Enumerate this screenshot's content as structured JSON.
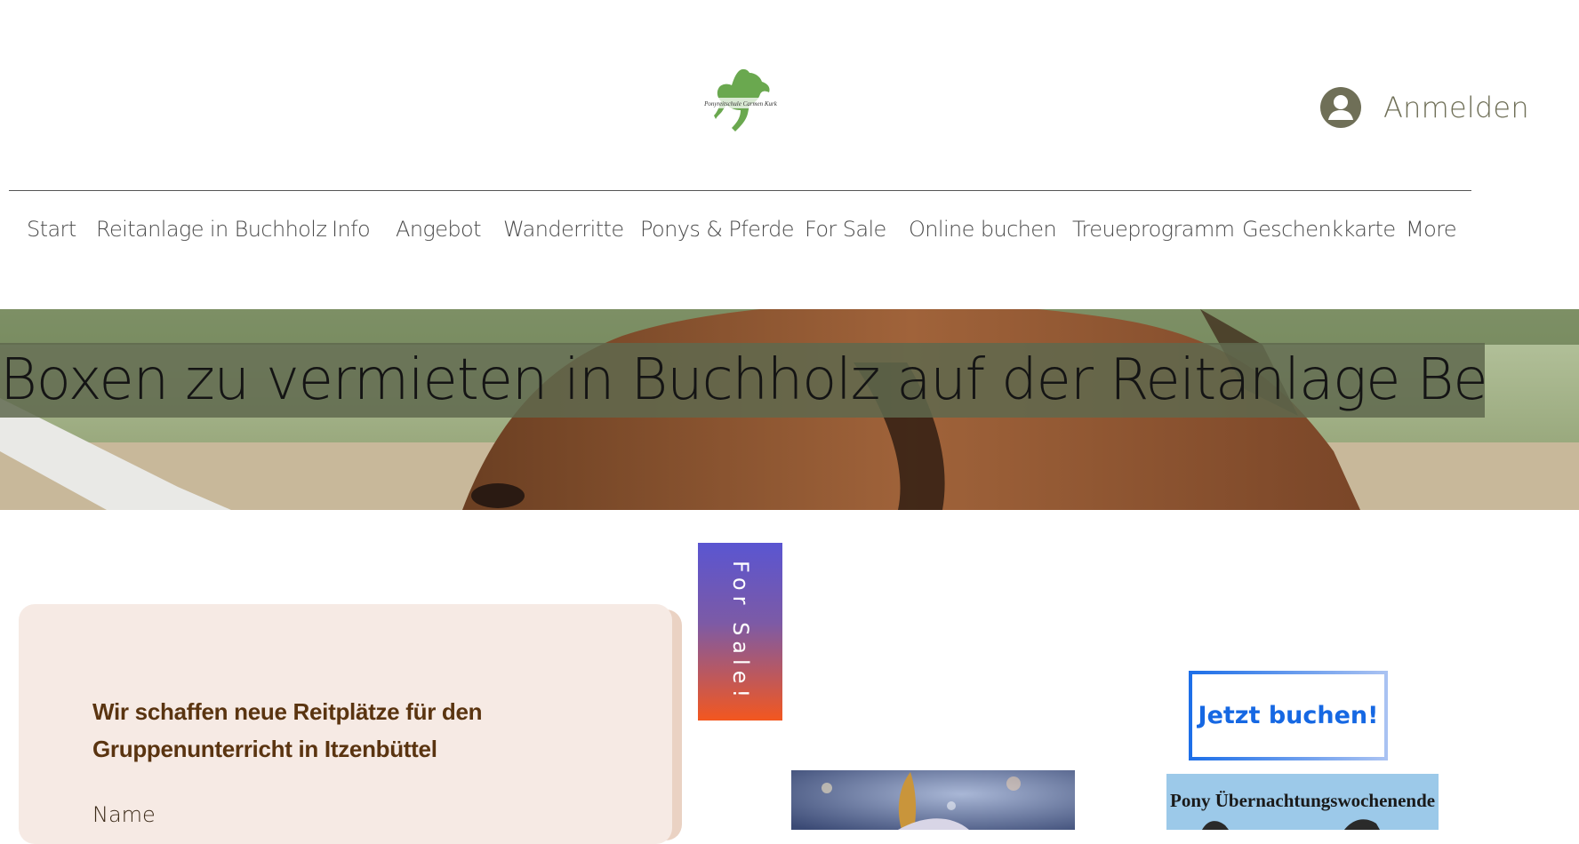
{
  "brand": {
    "logo_text": "Ponyreitschule Carmen Kurk",
    "logo_color": "#6aa84f"
  },
  "header": {
    "login_label": "Anmelden"
  },
  "nav": {
    "items": [
      "Start",
      "Reitanlage in Buchholz",
      "Info",
      "Angebot",
      "Wanderritte",
      "Ponys & Pferde",
      "For Sale",
      "Online buchen",
      "Treueprogramm",
      "Geschenkkarte",
      "More"
    ]
  },
  "hero": {
    "title": "Boxen zu vermieten in Buchholz auf der Reitanlage Behr!"
  },
  "forsale": {
    "label": "For Sale!"
  },
  "form": {
    "heading": "Wir schaffen neue Reitplätze für den Gruppenunterricht in Itzenbüttel",
    "name_label": "Name"
  },
  "cta": {
    "label": "Jetzt buchen!"
  },
  "gallery": {
    "pony_caption": "Pony Übernachtungswochenende"
  },
  "colors": {
    "accent_blue": "#1668e3",
    "hero_band": "#5f684e",
    "card_bg": "#f6eae4",
    "heading_brown": "#5a3410"
  }
}
